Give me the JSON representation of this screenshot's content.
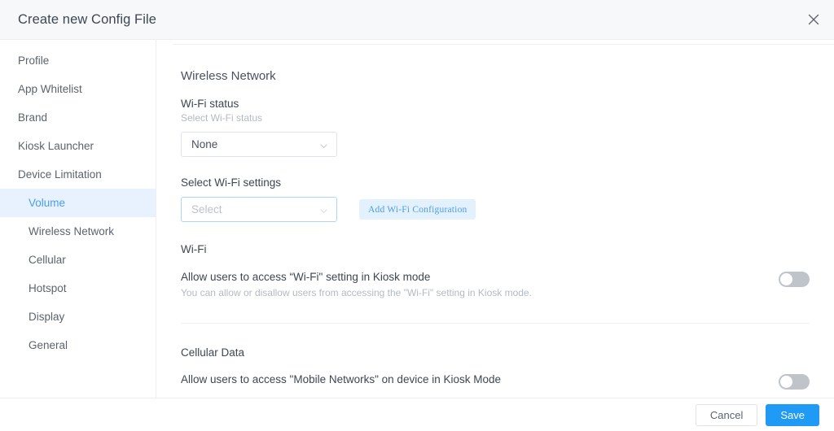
{
  "header": {
    "title": "Create new Config File",
    "close_icon": "close-icon"
  },
  "sidebar": {
    "items": [
      {
        "label": "Profile",
        "level": "top",
        "active": false
      },
      {
        "label": "App Whitelist",
        "level": "top",
        "active": false
      },
      {
        "label": "Brand",
        "level": "top",
        "active": false
      },
      {
        "label": "Kiosk Launcher",
        "level": "top",
        "active": false
      },
      {
        "label": "Device Limitation",
        "level": "top",
        "active": false
      },
      {
        "label": "Volume",
        "level": "sub",
        "active": true
      },
      {
        "label": "Wireless Network",
        "level": "sub",
        "active": false
      },
      {
        "label": "Cellular",
        "level": "sub",
        "active": false
      },
      {
        "label": "Hotspot",
        "level": "sub",
        "active": false
      },
      {
        "label": "Display",
        "level": "sub",
        "active": false
      },
      {
        "label": "General",
        "level": "sub",
        "active": false
      }
    ]
  },
  "content": {
    "section_title": "Wireless Network",
    "wifi_status": {
      "label": "Wi-Fi status",
      "hint": "Select Wi-Fi status",
      "selected": "None",
      "chevron_icon": "chevron-down-icon"
    },
    "wifi_settings": {
      "label": "Select Wi-Fi settings",
      "placeholder": "Select",
      "value": "",
      "chevron_icon": "chevron-down-icon",
      "add_button_label": "Add Wi-Fi Configuration"
    },
    "wifi_block": {
      "heading": "Wi-Fi",
      "toggle_label": "Allow users to access “Wi-Fi\" setting in Kiosk mode",
      "toggle_description": "You can allow or disallow users from accessing the \"Wi-Fi\" setting in Kiosk mode.",
      "toggle_state": "off"
    },
    "cellular_block": {
      "heading": "Cellular Data",
      "toggle_label": "Allow users to access \"Mobile Networks\" on device in Kiosk Mode",
      "toggle_state": "off"
    }
  },
  "footer": {
    "cancel_label": "Cancel",
    "save_label": "Save"
  },
  "colors": {
    "accent": "#1f9af5",
    "accent_light": "#4a9df0",
    "active_bg": "#e8f2fe",
    "button_light_bg": "#e3f1fd",
    "header_bg": "#f7f8fa",
    "switch_off": "#bfc4ca",
    "text_primary": "#3e4651",
    "text_muted": "#b4bac2"
  }
}
